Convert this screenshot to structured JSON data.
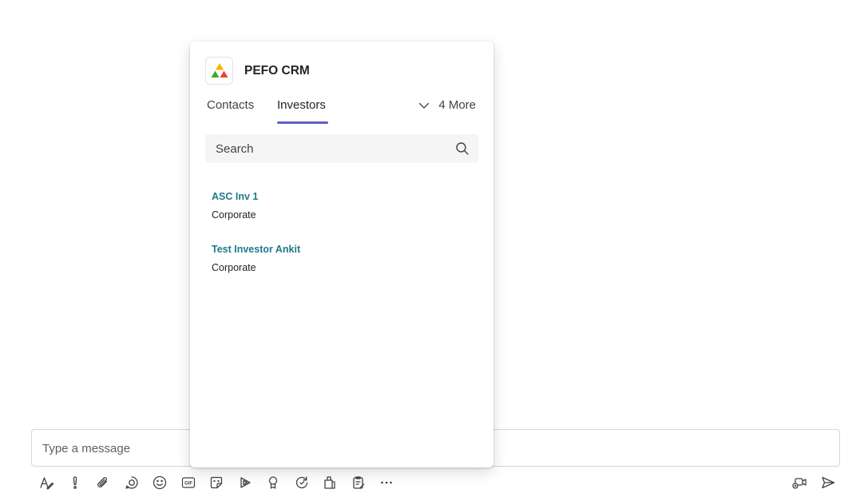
{
  "compose": {
    "placeholder": "Type a message"
  },
  "toolbar": {
    "left_icons": [
      "format-icon",
      "important-icon",
      "attach-icon",
      "loop-icon",
      "emoji-icon",
      "gif-icon",
      "sticker-icon",
      "stream-icon",
      "praise-icon",
      "updates-icon",
      "apps-icon",
      "forms-icon",
      "more-icon"
    ],
    "right_icons": [
      "meet-now-icon",
      "send-icon"
    ]
  },
  "popup": {
    "app_title": "PEFO CRM",
    "tabs": [
      {
        "label": "Contacts",
        "selected": false
      },
      {
        "label": "Investors",
        "selected": true
      }
    ],
    "more_label": "4 More",
    "search": {
      "placeholder": "Search"
    },
    "results": [
      {
        "name": "ASC Inv 1",
        "type": "Corporate"
      },
      {
        "name": "Test Investor Ankit",
        "type": "Corporate"
      }
    ]
  },
  "colors": {
    "accent": "#5b5fc7",
    "link": "#1f7a8c",
    "logo_yellow": "#f5b700",
    "logo_green": "#3aa935",
    "logo_red": "#e8432e"
  }
}
